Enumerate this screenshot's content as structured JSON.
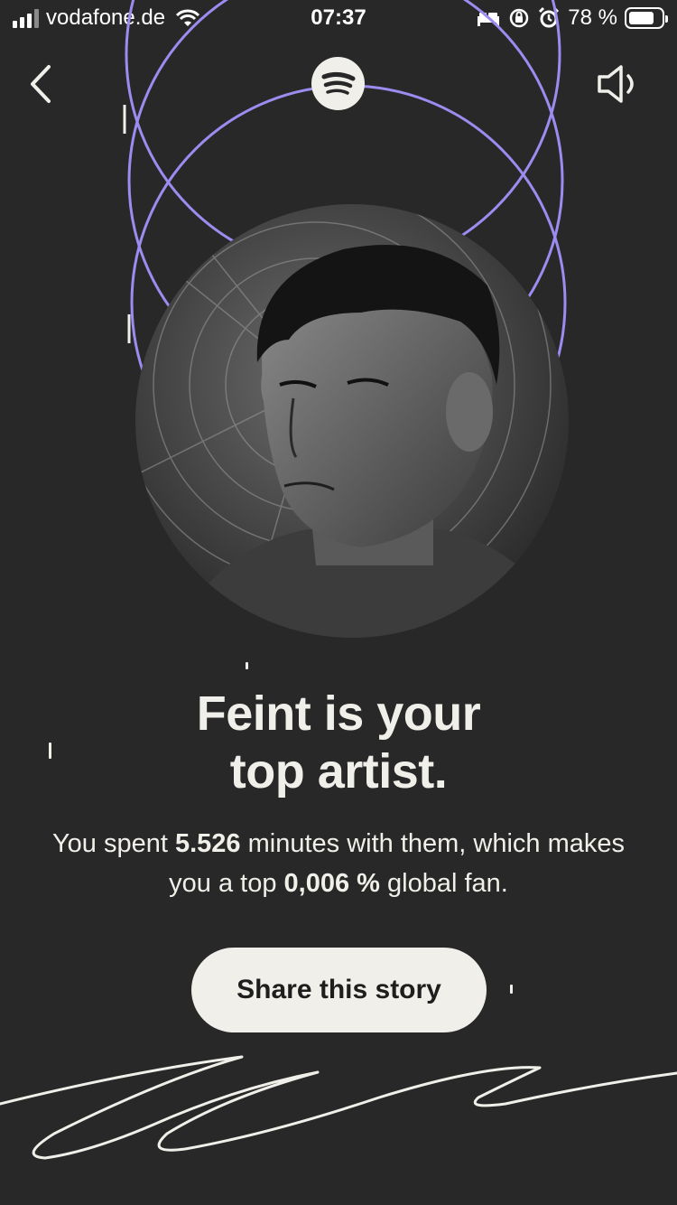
{
  "status_bar": {
    "carrier": "vodafone.de",
    "time": "07:37",
    "battery_percent": "78 %",
    "battery_level": 0.78,
    "icons": [
      "signal-icon",
      "wifi-icon",
      "bed-icon",
      "orientation-lock-icon",
      "alarm-icon",
      "battery-icon"
    ]
  },
  "nav": {
    "back_icon": "chevron-left-icon",
    "logo_icon": "spotify-logo",
    "sound_icon": "speaker-icon"
  },
  "story": {
    "headline_line1": "Feint is your",
    "headline_line2": "top artist.",
    "sub_part1": "You spent ",
    "sub_minutes": "5.526",
    "sub_part2": " minutes with them, which makes you a top ",
    "sub_percent": "0,006 %",
    "sub_part3": " global fan.",
    "share_label": "Share this story"
  },
  "colors": {
    "background": "#282828",
    "accent_circle": "#9b8cf0",
    "button_bg": "#f0efe9",
    "text": "#f0efe9"
  }
}
